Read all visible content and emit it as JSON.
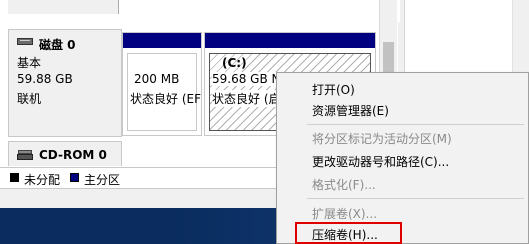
{
  "disk0": {
    "name": "磁盘 0",
    "type": "基本",
    "size": "59.88 GB",
    "status": "联机"
  },
  "partitions": [
    {
      "size": "200 MB",
      "status": "状态良好 (EF"
    },
    {
      "label": "(C:)",
      "size": "59.68 GB N",
      "status": "状态良好 (启"
    }
  ],
  "cdrom": {
    "name": "CD-ROM 0"
  },
  "legend": [
    {
      "label": "未分配",
      "color": "#000000"
    },
    {
      "label": "主分区",
      "color": "#000080"
    }
  ],
  "context_menu": {
    "items": [
      {
        "label": "打开(O)",
        "enabled": true
      },
      {
        "label": "资源管理器(E)",
        "enabled": true
      },
      {
        "label": "将分区标记为活动分区(M)",
        "enabled": false
      },
      {
        "label": "更改驱动器号和路径(C)...",
        "enabled": true
      },
      {
        "label": "格式化(F)...",
        "enabled": false
      },
      {
        "label": "扩展卷(X)...",
        "enabled": false
      },
      {
        "label": "压缩卷(H)...",
        "enabled": true
      }
    ]
  },
  "colors": {
    "primary_partition": "#000080",
    "unallocated": "#000000",
    "highlight": "#e00000",
    "desktop": "#0a2c5e"
  }
}
